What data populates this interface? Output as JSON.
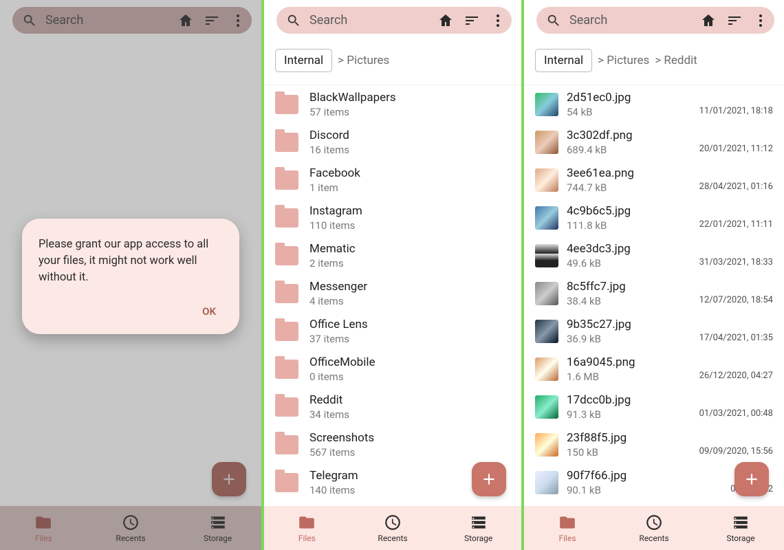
{
  "search": {
    "placeholder": "Search"
  },
  "pane1": {
    "dialog": {
      "message": "Please grant our app access to all your files, it might not work well without it.",
      "ok": "OK"
    }
  },
  "pane2": {
    "breadcrumb": {
      "root": "Internal",
      "crumb1": "> Pictures"
    },
    "items": [
      {
        "name": "BlackWallpapers",
        "sub": "57 items"
      },
      {
        "name": "Discord",
        "sub": "16 items"
      },
      {
        "name": "Facebook",
        "sub": "1 item"
      },
      {
        "name": "Instagram",
        "sub": "110 items"
      },
      {
        "name": "Mematic",
        "sub": "2 items"
      },
      {
        "name": "Messenger",
        "sub": "4 items"
      },
      {
        "name": "Office Lens",
        "sub": "37 items"
      },
      {
        "name": "OfficeMobile",
        "sub": "0 items"
      },
      {
        "name": "Reddit",
        "sub": "34 items"
      },
      {
        "name": "Screenshots",
        "sub": "567 items"
      },
      {
        "name": "Telegram",
        "sub": "140 items"
      }
    ]
  },
  "pane3": {
    "breadcrumb": {
      "root": "Internal",
      "crumb1": "> Pictures",
      "crumb2": "> Reddit"
    },
    "items": [
      {
        "name": "2d51ec0.jpg",
        "sub": "54 kB",
        "date": "11/01/2021, 18:18"
      },
      {
        "name": "3c302df.png",
        "sub": "689.4 kB",
        "date": "20/01/2021, 11:12"
      },
      {
        "name": "3ee61ea.png",
        "sub": "744.7 kB",
        "date": "28/04/2021, 01:16"
      },
      {
        "name": "4c9b6c5.jpg",
        "sub": "111.8 kB",
        "date": "22/01/2021, 11:11"
      },
      {
        "name": "4ee3dc3.jpg",
        "sub": "49.6 kB",
        "date": "31/03/2021, 18:33"
      },
      {
        "name": "8c5ffc7.jpg",
        "sub": "38.4 kB",
        "date": "12/07/2020, 18:54"
      },
      {
        "name": "9b35c27.jpg",
        "sub": "36.9 kB",
        "date": "17/04/2021, 01:35"
      },
      {
        "name": "16a9045.png",
        "sub": "1.6 MB",
        "date": "26/12/2020, 04:27"
      },
      {
        "name": "17dcc0b.jpg",
        "sub": "91.3 kB",
        "date": "01/03/2021, 00:48"
      },
      {
        "name": "23f88f5.jpg",
        "sub": "150 kB",
        "date": "09/09/2020, 15:56"
      },
      {
        "name": "90f7f66.jpg",
        "sub": "90.1 kB",
        "date": "06/05/202"
      }
    ]
  },
  "nav": {
    "files": "Files",
    "recents": "Recents",
    "storage": "Storage"
  }
}
